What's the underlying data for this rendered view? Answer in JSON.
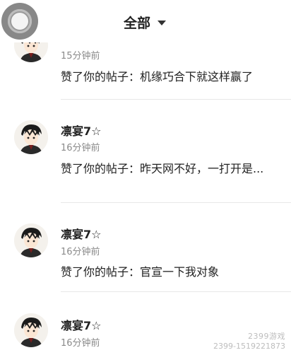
{
  "header": {
    "title": "全部",
    "dropdown_icon": "caret-down-icon"
  },
  "float_ball_icon": "assistive-touch-icon",
  "notifications": [
    {
      "name": "",
      "time": "15分钟前",
      "content": "赞了你的帖子：机缘巧合下就这样赢了"
    },
    {
      "name": "凛宴7☆",
      "time": "16分钟前",
      "content": "赞了你的帖子：昨天网不好，一打开是..."
    },
    {
      "name": "凛宴7☆",
      "time": "16分钟前",
      "content": "赞了你的帖子：官宣一下我对象"
    },
    {
      "name": "凛宴7☆",
      "time": "16分钟前",
      "content": ""
    }
  ],
  "watermark": {
    "logo": "2399游戏",
    "text": "2399-1519221873"
  }
}
